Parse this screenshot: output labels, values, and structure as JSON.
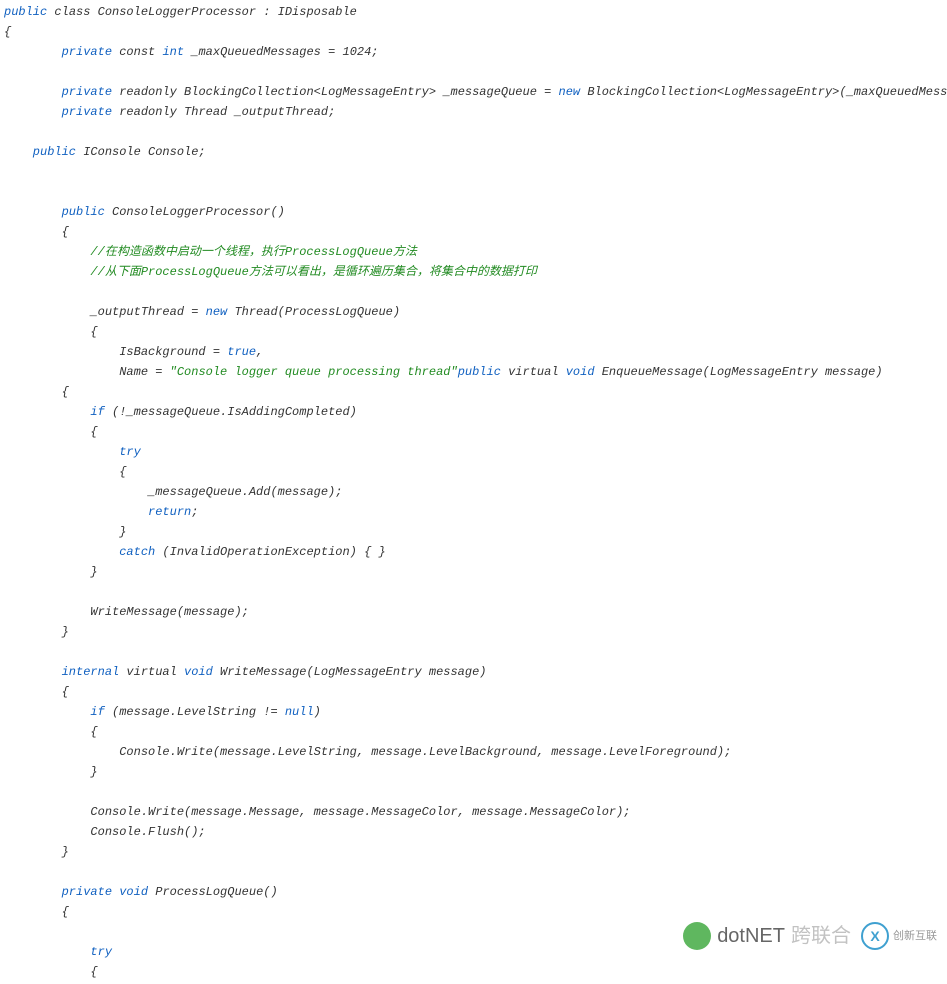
{
  "code": {
    "l1a": "public",
    "l1b": " class ConsoleLoggerProcessor : IDisposable",
    "l2": "{",
    "l3a": "        private",
    "l3b": " const ",
    "l3c": "int",
    "l3d": " _maxQueuedMessages = 1024;",
    "l4a": "        private",
    "l4b": " readonly BlockingCollection<LogMessageEntry> _messageQueue = ",
    "l4c": "new",
    "l4d": " BlockingCollection<LogMessageEntry>(_maxQueuedMessages);",
    "l5a": "        private",
    "l5b": " readonly Thread _outputThread;",
    "l6a": "    public",
    "l6b": " IConsole Console;",
    "l7a": "        public",
    "l7b": " ConsoleLoggerProcessor()",
    "l8": "        {",
    "l9": "            //在构造函数中启动一个线程，执行ProcessLogQueue方法",
    "l10": "            //从下面ProcessLogQueue方法可以看出，是循环遍历集合，将集合中的数据打印",
    "l11a": "            _outputThread = ",
    "l11b": "new",
    "l11c": " Thread(ProcessLogQueue)",
    "l12": "            {",
    "l13a": "                IsBackground = ",
    "l13b": "true",
    "l13c": ",",
    "l14a": "                Name = ",
    "l14b": "\"Console logger queue processing thread\"",
    "l14c": "public",
    "l14d": " virtual ",
    "l14e": "void",
    "l14f": " EnqueueMessage(LogMessageEntry message)",
    "l15": "        {",
    "l16a": "            if",
    "l16b": " (!_messageQueue.IsAddingCompleted)",
    "l17": "            {",
    "l18": "                try",
    "l19": "                {",
    "l20": "                    _messageQueue.Add(message);",
    "l21a": "                    return",
    "l21b": ";",
    "l22": "                }",
    "l23a": "                catch",
    "l23b": " (InvalidOperationException) { }",
    "l24": "            }",
    "l25": "            WriteMessage(message);",
    "l26": "        }",
    "l27a": "        internal",
    "l27b": " virtual ",
    "l27c": "void",
    "l27d": " WriteMessage(LogMessageEntry message)",
    "l28": "        {",
    "l29a": "            if",
    "l29b": " (message.LevelString != ",
    "l29c": "null",
    "l29d": ")",
    "l30": "            {",
    "l31": "                Console.Write(message.LevelString, message.LevelBackground, message.LevelForeground);",
    "l32": "            }",
    "l33": "            Console.Write(message.Message, message.MessageColor, message.MessageColor);",
    "l34": "            Console.Flush();",
    "l35": "        }",
    "l36a": "        private",
    "l36b": " void",
    "l36c": " ProcessLogQueue()",
    "l37": "        {",
    "l38": "            try",
    "l39": "            {"
  },
  "watermark": {
    "text1": "dotNET",
    "text1b": "跨联合",
    "logo2_text": "X",
    "text2": "创新互联"
  }
}
